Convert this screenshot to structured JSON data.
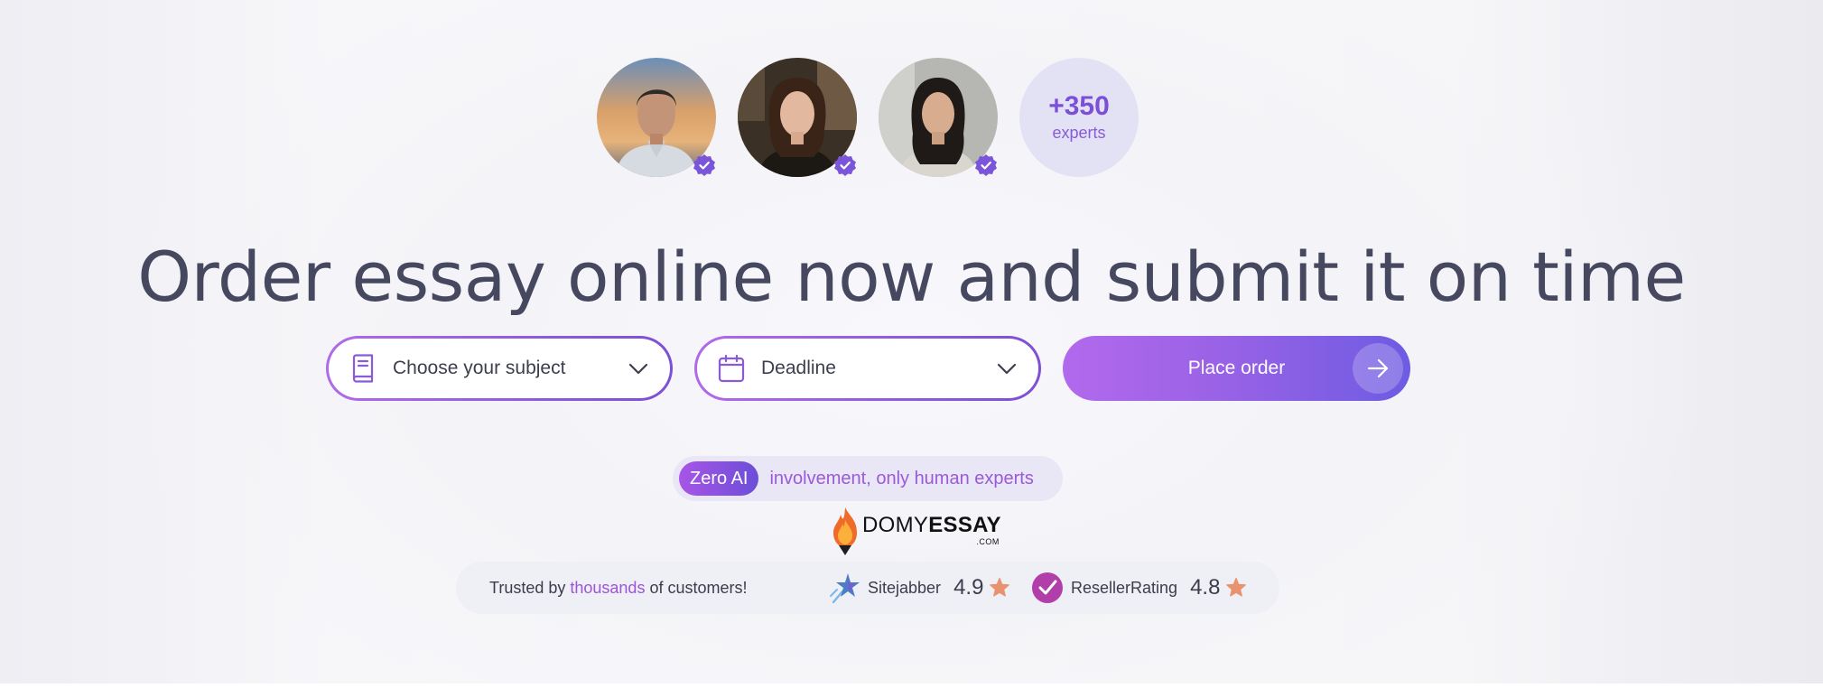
{
  "experts": {
    "avatars": [
      {
        "name": "expert-1",
        "verified": true
      },
      {
        "name": "expert-2",
        "verified": true
      },
      {
        "name": "expert-3",
        "verified": true
      }
    ],
    "count": "+350",
    "count_label": "experts"
  },
  "headline": "Order essay online now and submit it on time",
  "form": {
    "subject_placeholder": "Choose your subject",
    "deadline_placeholder": "Deadline",
    "submit_label": "Place order"
  },
  "zero_ai": {
    "tag": "Zero AI",
    "text": "involvement, only human experts"
  },
  "logo": {
    "brand_light": "DOMY",
    "brand_bold": "ESSAY",
    "suffix": ".COM"
  },
  "trust": {
    "prefix": "Trusted by ",
    "highlight": "thousands",
    "suffix": " of customers!",
    "ratings": [
      {
        "site": "Sitejabber",
        "score": "4.9",
        "icon": "sitejabber-icon"
      },
      {
        "site": "ResellerRating",
        "score": "4.8",
        "icon": "resellerrating-icon"
      }
    ]
  },
  "colors": {
    "accent_purple": "#8f5ce0",
    "headline": "#464860",
    "star": "#e8926f",
    "badge": "#7b55d9"
  }
}
